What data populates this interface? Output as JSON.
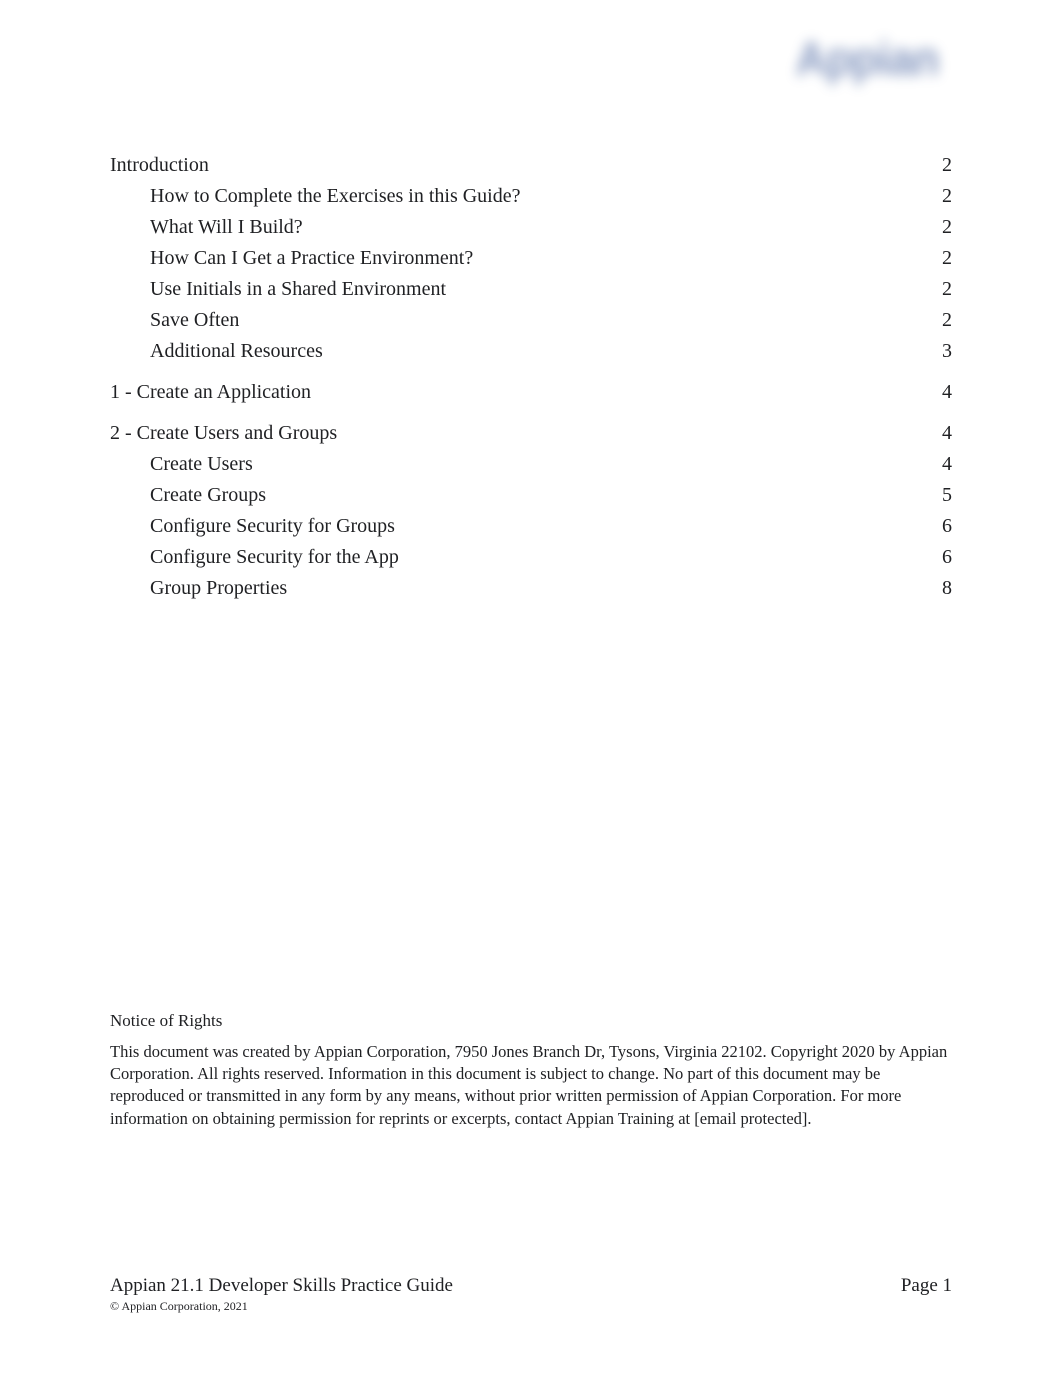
{
  "logo": {
    "text": "Appian"
  },
  "toc": [
    {
      "title": "Introduction",
      "page": "2",
      "children": [
        {
          "title": "How to Complete the Exercises in this Guide?",
          "page": "2"
        },
        {
          "title": "What Will I Build?",
          "page": "2"
        },
        {
          "title": "How Can I Get a Practice Environment?",
          "page": "2"
        },
        {
          "title": "Use Initials in a Shared Environment",
          "page": "2"
        },
        {
          "title": "Save Often",
          "page": "2"
        },
        {
          "title": "Additional Resources",
          "page": "3"
        }
      ]
    },
    {
      "title": "1 - Create an Application",
      "page": "4",
      "children": []
    },
    {
      "title": "2 - Create Users and Groups",
      "page": "4",
      "children": [
        {
          "title": "Create Users",
          "page": "4"
        },
        {
          "title": "Create Groups",
          "page": "5"
        },
        {
          "title": "Configure Security for Groups",
          "page": "6"
        },
        {
          "title": "Configure Security for the App",
          "page": "6"
        },
        {
          "title": "Group Properties",
          "page": "8"
        }
      ]
    }
  ],
  "notice": {
    "heading": "Notice of Rights",
    "body": "This document was created by Appian Corporation, 7950 Jones Branch Dr, Tysons, Virginia 22102. Copyright 2020 by Appian Corporation. All rights reserved.        Information in this document is subject to change. No part of this document may be reproduced or transmitted in any form by any means, without prior written permission of Appian Corporation. For more information on obtaining permission for reprints or excerpts, contact Appian Training at [email protected]."
  },
  "footer": {
    "title": "Appian 21.1 Developer Skills Practice Guide",
    "page_label": "Page 1",
    "copyright": "© Appian Corporation, 2021"
  }
}
